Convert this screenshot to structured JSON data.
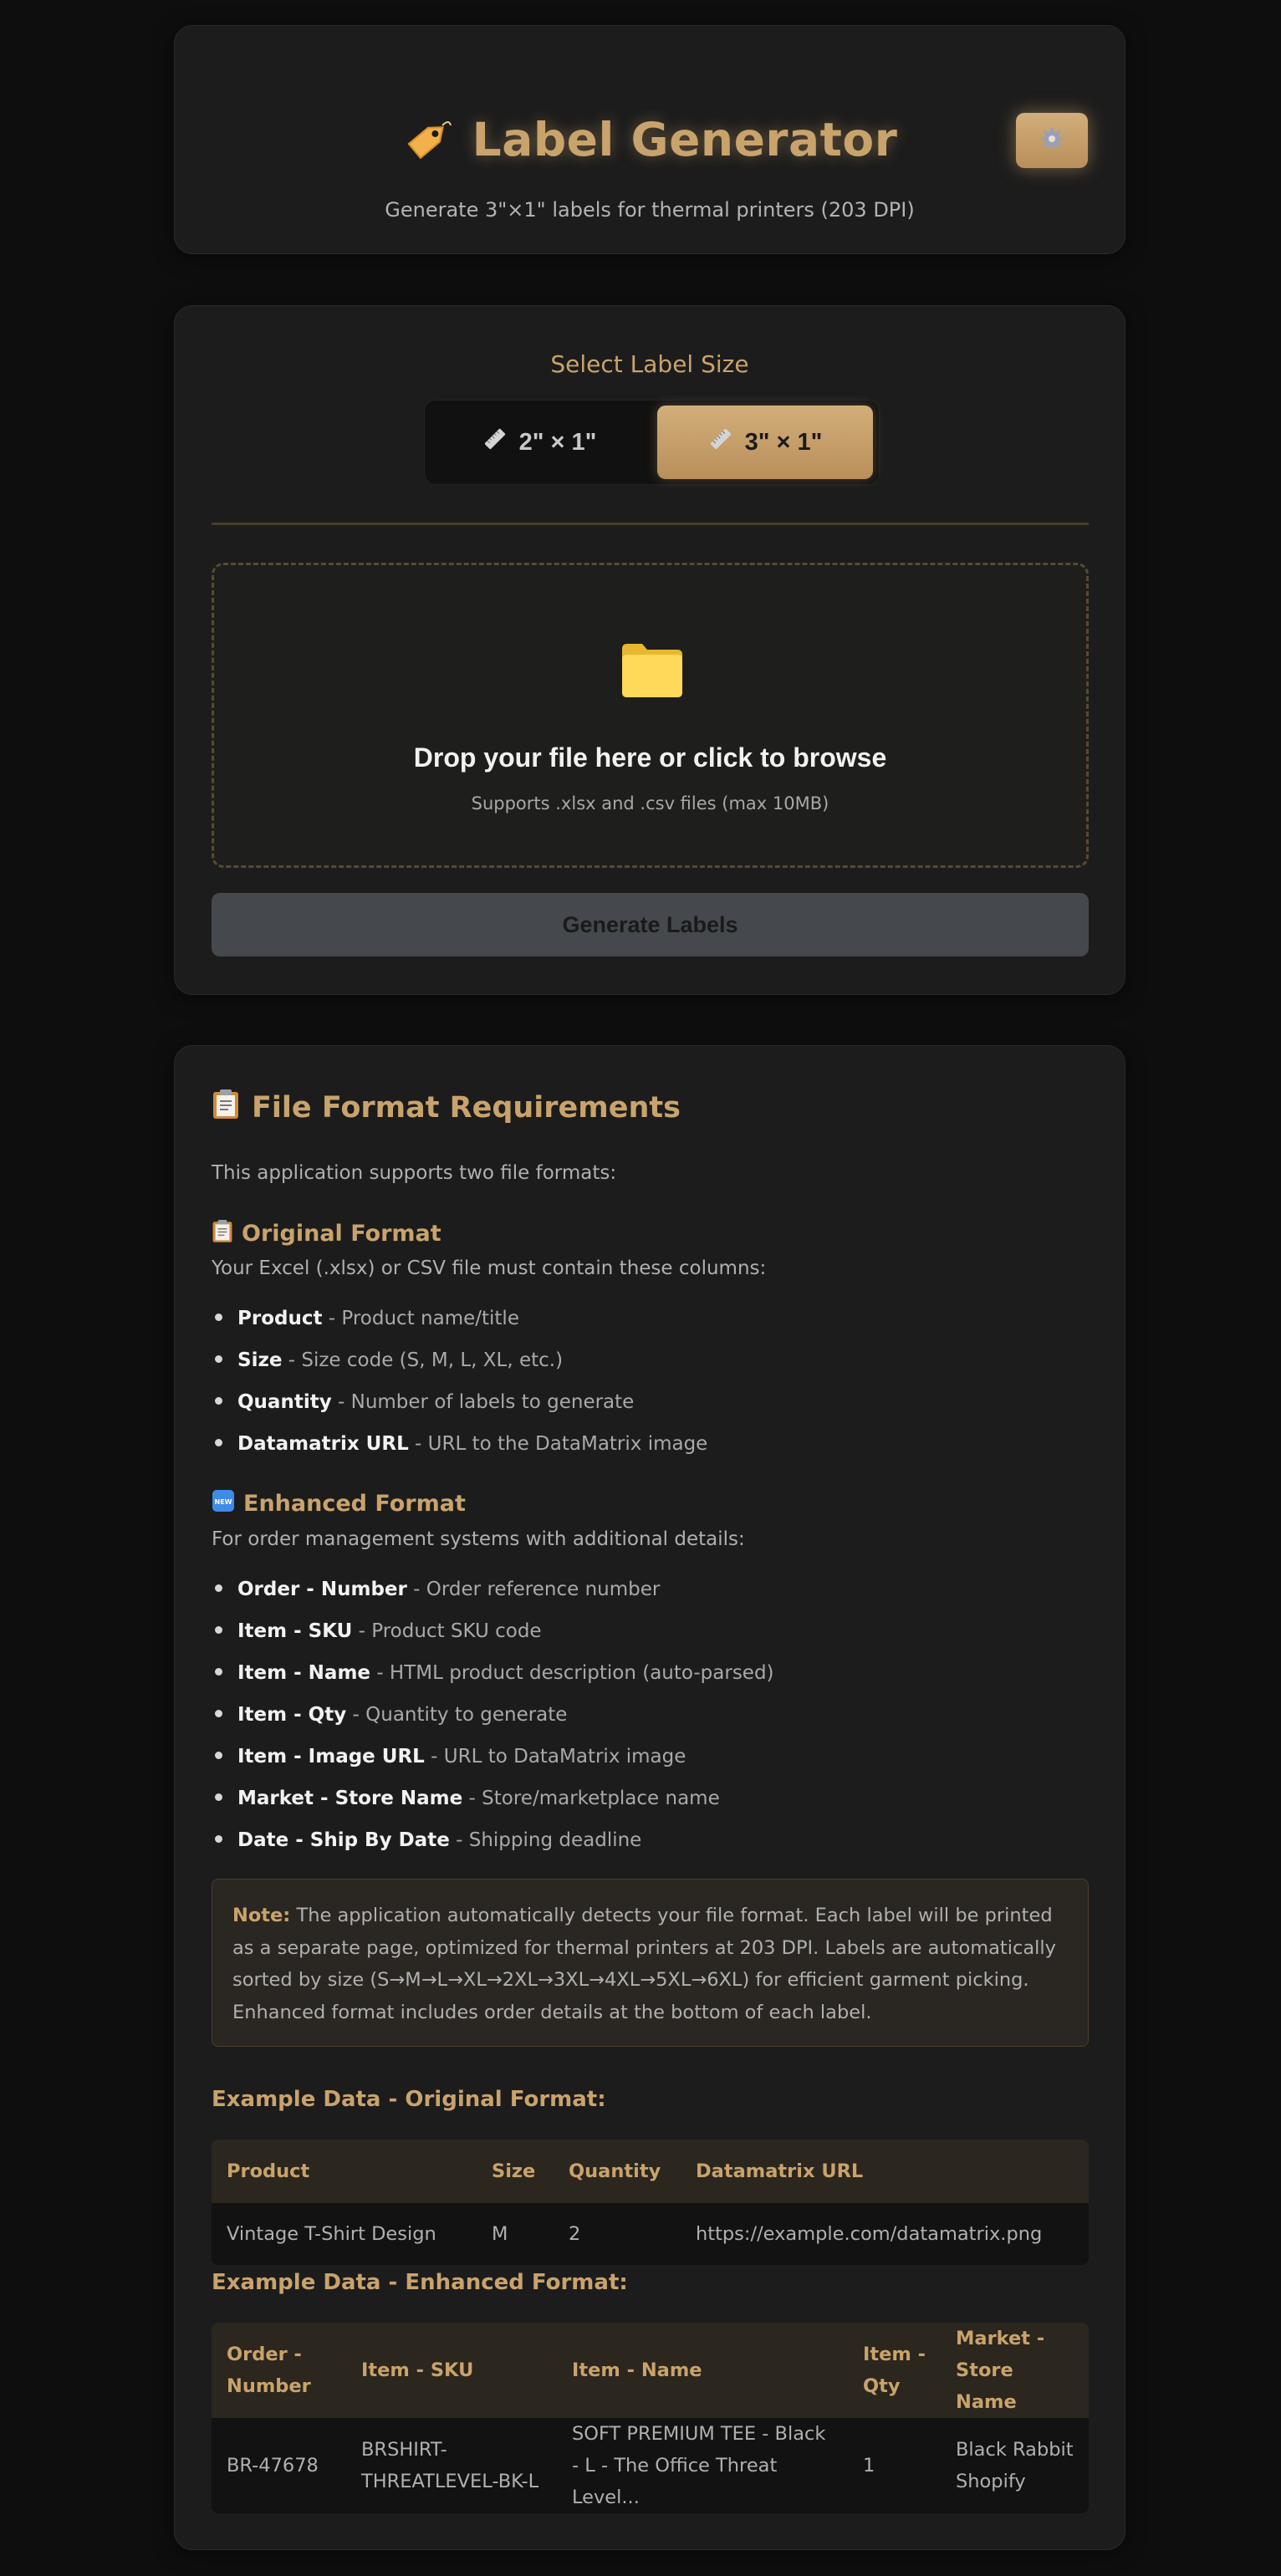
{
  "header": {
    "title": "Label Generator",
    "subtitle": "Generate 3\"×1\" labels for thermal printers (203 DPI)",
    "tag_icon": "tag-icon",
    "settings_icon": "gear-icon"
  },
  "size_selector": {
    "heading": "Select Label Size",
    "options": [
      {
        "label": "2\" × 1\"",
        "icon": "ruler-icon",
        "selected": false
      },
      {
        "label": "3\" × 1\"",
        "icon": "ruler-icon",
        "selected": true
      }
    ]
  },
  "upload": {
    "icon": "folder-icon",
    "title": "Drop your file here or click to browse",
    "subtitle": "Supports .xlsx and .csv files (max 10MB)"
  },
  "generate_button": "Generate Labels",
  "requirements": {
    "title": "File Format Requirements",
    "intro": "This application supports two file formats:",
    "original": {
      "title": "Original Format",
      "desc": "Your Excel (.xlsx) or CSV file must contain these columns:",
      "items": [
        {
          "name": "Product",
          "desc": " - Product name/title"
        },
        {
          "name": "Size",
          "desc": " - Size code (S, M, L, XL, etc.)"
        },
        {
          "name": "Quantity",
          "desc": " - Number of labels to generate"
        },
        {
          "name": "Datamatrix URL",
          "desc": " - URL to the DataMatrix image"
        }
      ]
    },
    "enhanced": {
      "title": "Enhanced Format",
      "desc": "For order management systems with additional details:",
      "items": [
        {
          "name": "Order - Number",
          "desc": " - Order reference number"
        },
        {
          "name": "Item - SKU",
          "desc": " - Product SKU code"
        },
        {
          "name": "Item - Name",
          "desc": " - HTML product description (auto-parsed)"
        },
        {
          "name": "Item - Qty",
          "desc": " - Quantity to generate"
        },
        {
          "name": "Item - Image URL",
          "desc": " - URL to DataMatrix image"
        },
        {
          "name": "Market - Store Name",
          "desc": " - Store/marketplace name"
        },
        {
          "name": "Date - Ship By Date",
          "desc": " - Shipping deadline"
        }
      ]
    },
    "note_label": "Note:",
    "note_text": " The application automatically detects your file format. Each label will be printed as a separate page, optimized for thermal printers at 203 DPI. Labels are automatically sorted by size (S→M→L→XL→2XL→3XL→4XL→5XL→6XL) for efficient garment picking. Enhanced format includes order details at the bottom of each label.",
    "example_original": {
      "title": "Example Data - Original Format:",
      "headers": [
        "Product",
        "Size",
        "Quantity",
        "Datamatrix URL"
      ],
      "rows": [
        [
          "Vintage T-Shirt Design",
          "M",
          "2",
          "https://example.com/datamatrix.png"
        ]
      ]
    },
    "example_enhanced": {
      "title": "Example Data - Enhanced Format:",
      "headers": [
        "Order - Number",
        "Item - SKU",
        "Item - Name",
        "Item - Qty",
        "Market - Store Name"
      ],
      "rows": [
        [
          "BR-47678",
          "BRSHIRT-THREATLEVEL-BK-L",
          "SOFT PREMIUM TEE - Black - L - The Office Threat Level...",
          "1",
          "Black Rabbit Shopify"
        ]
      ]
    }
  },
  "colors": {
    "accent": "#c9a36c",
    "background": "#0e0e0e",
    "card": "#1c1c1c"
  }
}
